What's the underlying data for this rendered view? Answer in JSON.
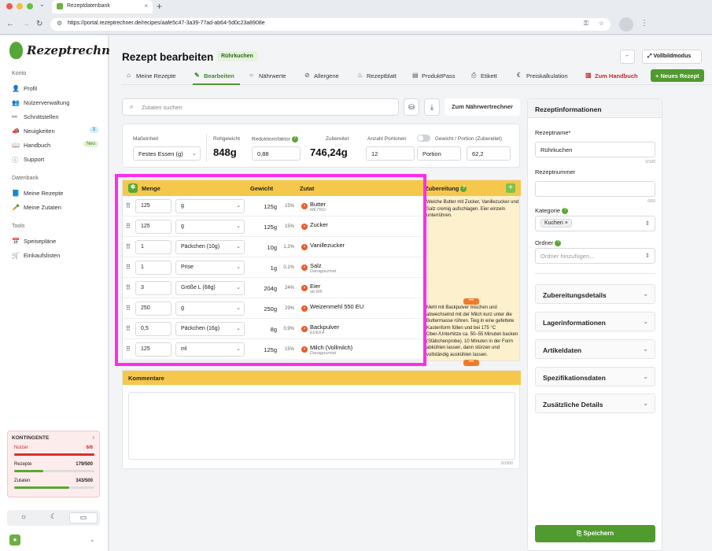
{
  "browser": {
    "tab_title": "Rezeptdatenbank",
    "url": "https://portal.rezeptrechner.de/recipes/aafe5c47-3a39-77ad-ab64-5d0c23a8908e"
  },
  "brand": {
    "name": "Rezeptrechner",
    "accent": "#4f9b2e"
  },
  "sidebar": {
    "sections": [
      {
        "title": "Konto",
        "items": [
          "Profil",
          "Nutzerverwaltung",
          "Schnittstellen",
          "Neuigkeiten",
          "Handbuch",
          "Support"
        ]
      },
      {
        "title": "Datenbank",
        "items": [
          "Meine Rezepte",
          "Meine Zutaten"
        ]
      },
      {
        "title": "Tools",
        "items": [
          "Speisepläne",
          "Einkaufslisten"
        ]
      }
    ],
    "neuigkeiten_badge": "3",
    "handbuch_badge": "Neu",
    "kontingente": {
      "title": "KONTINGENTE",
      "nutzer_label": "Nutzer",
      "nutzer_value": "6/6",
      "nutzer_fill": 1.0,
      "rezepte_label": "Rezepte",
      "rezepte_value": "179/500",
      "rezepte_fill": 0.358,
      "zutaten_label": "Zutaten",
      "zutaten_value": "343/500",
      "zutaten_fill": 0.686
    }
  },
  "header": {
    "title": "Rezept bearbeiten",
    "recipe_chip": "Rührkuchen",
    "fullscreen_label": "Vollbildmodus",
    "tabs": [
      "Meine Rezepte",
      "Bearbeiten",
      "Nährwerte",
      "Allergene",
      "Rezeptblatt",
      "ProduktPass",
      "Etikett",
      "Preiskalkulation"
    ],
    "handbuch_link": "Zum Handbuch",
    "new_recipe": "+ Neues Rezept"
  },
  "toolbar": {
    "search_placeholder": "Zutaten suchen",
    "nutrition_button": "Zum Nährwertrechner"
  },
  "infobar": {
    "masseinheit_label": "Maßeinheit",
    "masseinheit_value": "Festes Essen (g)",
    "rohgewicht_label": "Rohgewicht",
    "rohgewicht_value": "848g",
    "reduktion_label": "Reduktionsfaktor",
    "reduktion_value": "0,88",
    "zubereitet_label": "Zubereitet",
    "zubereitet_value": "746,24g",
    "portionen_label": "Anzahl Portionen",
    "portionen_value": "12",
    "gewicht_portion_label": "Gewicht / Portion (Zubereitet)",
    "portion_unit": "Portion",
    "portion_weight": "62,2"
  },
  "ingredients": {
    "headers": {
      "menge": "Menge",
      "gewicht": "Gewicht",
      "zutat": "Zutat"
    },
    "rows": [
      {
        "amount": "125",
        "unit": "g",
        "weight": "125g",
        "pct": "15%",
        "name": "Butter",
        "source": "METRO"
      },
      {
        "amount": "125",
        "unit": "g",
        "weight": "125g",
        "pct": "15%",
        "name": "Zucker",
        "source": ""
      },
      {
        "amount": "1",
        "unit": "Päckchen (10g)",
        "weight": "10g",
        "pct": "1,2%",
        "name": "Vanillezucker",
        "source": ""
      },
      {
        "amount": "1",
        "unit": "Prise",
        "weight": "1g",
        "pct": "0,1%",
        "name": "Salz",
        "source": "Danagourmet"
      },
      {
        "amount": "3",
        "unit": "Größe L (68g)",
        "weight": "204g",
        "pct": "24%",
        "name": "Eier",
        "source": "ab Wil"
      },
      {
        "amount": "250",
        "unit": "g",
        "weight": "250g",
        "pct": "29%",
        "name": "Weizenmehl 550 EU",
        "source": ""
      },
      {
        "amount": "0,5",
        "unit": "Päckchen (16g)",
        "weight": "8g",
        "pct": "0,9%",
        "name": "Backpulver",
        "source": "EDEKA"
      },
      {
        "amount": "125",
        "unit": "ml",
        "weight": "125g",
        "pct": "15%",
        "name": "Milch (Vollmilch)",
        "source": "Danagourmet"
      }
    ]
  },
  "preparation": {
    "title": "Zubereitung",
    "step1": "Weiche Butter mit Zucker, Vanillezucker und Salz cremig aufschlagen. Eier einzeln unterrühren.",
    "step2": "Mehl mit Backpulver mischen und abwechselnd mit der Milch kurz unter die Buttermasse rühren. Teig in eine gefettete Kastenform füllen und bei 175 °C Ober-/Unterhitze ca. 50–55 Minuten backen (Stäbchenprobe). 10 Minuten in der Form abkühlen lassen, dann stürzen und vollständig auskühlen lassen.",
    "more": "•••"
  },
  "comments": {
    "title": "Kommentare",
    "counter": "0/1000"
  },
  "right_panel": {
    "title": "Rezeptinformationen",
    "name_label": "Rezeptname*",
    "name_value": "Rührkuchen",
    "name_counter": "0/100",
    "number_label": "Rezeptnummer",
    "number_value": "",
    "number_counter": "0/50",
    "category_label": "Kategorie",
    "category_value": "Kuchen",
    "folder_label": "Ordner",
    "folder_placeholder": "Ordner hinzufügen...",
    "accordions": [
      "Zubereitungsdetails",
      "Lagerinformationen",
      "Artikeldaten",
      "Spezifikationsdaten",
      "Zusätzliche Details"
    ],
    "save": "Speichern"
  }
}
